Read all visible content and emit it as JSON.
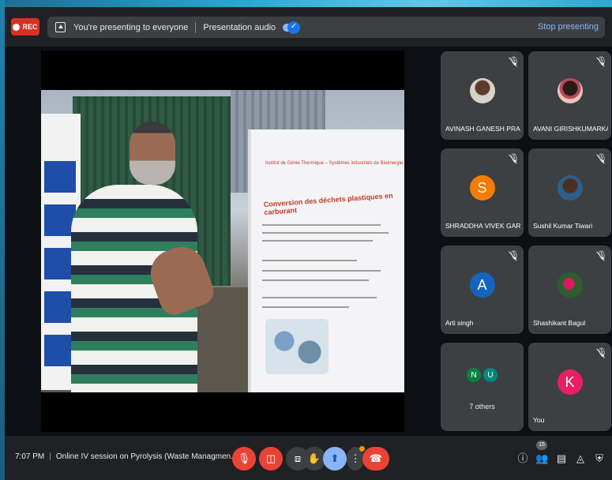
{
  "topbar": {
    "rec_label": "REC",
    "presenting_text": "You're presenting to everyone",
    "audio_label": "Presentation audio",
    "stop_label": "Stop presenting"
  },
  "poster": {
    "title": "Conversion des déchets plastiques en carburant",
    "institute": "Institut de Génie Thermique – Systèmes industriels de Bioénergie"
  },
  "participants": [
    {
      "name": "AVINASH GANESH PRAS...",
      "muted": true,
      "avatar": "photo"
    },
    {
      "name": "AVANI GIRISHKUMARKA...",
      "muted": true,
      "avatar": "photo"
    },
    {
      "name": "SHRADDHA VIVEK GARG",
      "muted": true,
      "initial": "S",
      "color": "#f57c00"
    },
    {
      "name": "Sushil Kumar Tiwari",
      "muted": true,
      "avatar": "photo"
    },
    {
      "name": "Arti singh",
      "muted": true,
      "initial": "A",
      "color": "#1565c0"
    },
    {
      "name": "Shashikant Bagul",
      "muted": true,
      "avatar": "photo"
    },
    {
      "others_label": "7 others",
      "initials": [
        "N",
        "U"
      ],
      "colors": [
        "#0b8043",
        "#00897b"
      ]
    },
    {
      "name": "You",
      "muted": true,
      "initial": "K",
      "color": "#e91e63"
    }
  ],
  "bottombar": {
    "time": "7:07 PM",
    "meeting_title": "Online IV session on Pyrolysis (Waste Managmen...",
    "people_count": "15"
  },
  "icons": {
    "mic_off": "mic-off-icon",
    "camera_off": "camera-off-icon",
    "captions": "captions-icon",
    "raise_hand": "raise-hand-icon",
    "present": "present-icon",
    "more": "more-options-icon",
    "hang_up": "hang-up-icon",
    "info": "info-icon",
    "people": "people-icon",
    "chat": "chat-icon",
    "activities": "activities-icon",
    "host_controls": "host-controls-icon"
  }
}
